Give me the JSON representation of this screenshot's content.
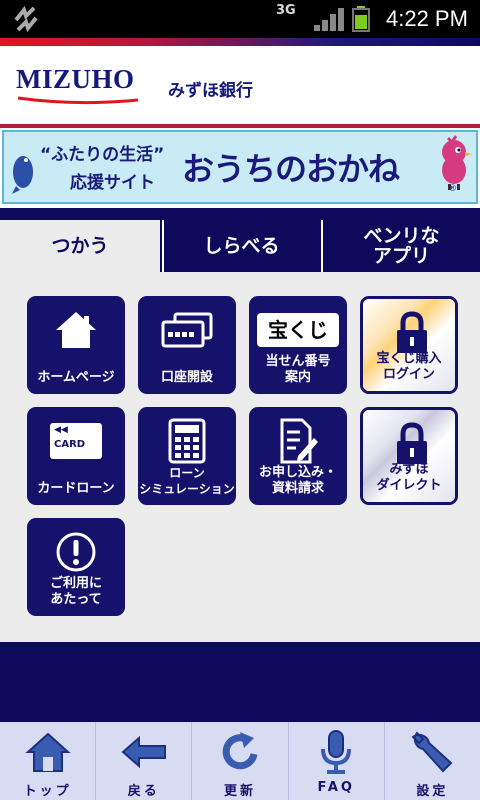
{
  "status_bar": {
    "network": "3G",
    "time": "4:22 PM"
  },
  "header": {
    "logo_text": "MIZUHO",
    "bank_name": "みずほ銀行"
  },
  "banner": {
    "subtitle_line1": "“ふたりの生活”",
    "subtitle_line2": "応援サイト",
    "title": "おうちのおかね",
    "registered_mark": "®"
  },
  "tabs": [
    {
      "label": "つかう",
      "active": true
    },
    {
      "label": "しらべる",
      "active": false
    },
    {
      "label": "ベンリな\nアプリ",
      "active": false
    }
  ],
  "tiles": [
    {
      "label": "ホームページ",
      "icon": "home-icon"
    },
    {
      "label": "口座開設",
      "icon": "cards-icon"
    },
    {
      "label": "当せん番号\n案内",
      "icon": "takarakuji-icon",
      "icon_text": "宝くじ"
    },
    {
      "label": "宝くじ購入\nログイン",
      "icon": "lock-icon"
    },
    {
      "label": "カードローン",
      "icon": "card-icon",
      "icon_text": "CARD"
    },
    {
      "label": "ローン\nシミュレーション",
      "icon": "calculator-icon"
    },
    {
      "label": "お申し込み・\n資料請求",
      "icon": "document-edit-icon"
    },
    {
      "label": "みずほ\nダイレクト",
      "icon": "lock-icon"
    },
    {
      "label": "ご利用に\nあたって",
      "icon": "info-icon"
    }
  ],
  "toolbar": [
    {
      "label": "トップ",
      "icon": "home-icon"
    },
    {
      "label": "戻る",
      "icon": "back-arrow-icon"
    },
    {
      "label": "更新",
      "icon": "refresh-icon"
    },
    {
      "label": "FAQ",
      "icon": "microphone-icon"
    },
    {
      "label": "設定",
      "icon": "wrench-icon"
    }
  ],
  "colors": {
    "navy": "#0d0a5c",
    "tile_navy": "#14126a",
    "banner_bg": "#c8ebf5",
    "brand_red": "#e0161f"
  }
}
